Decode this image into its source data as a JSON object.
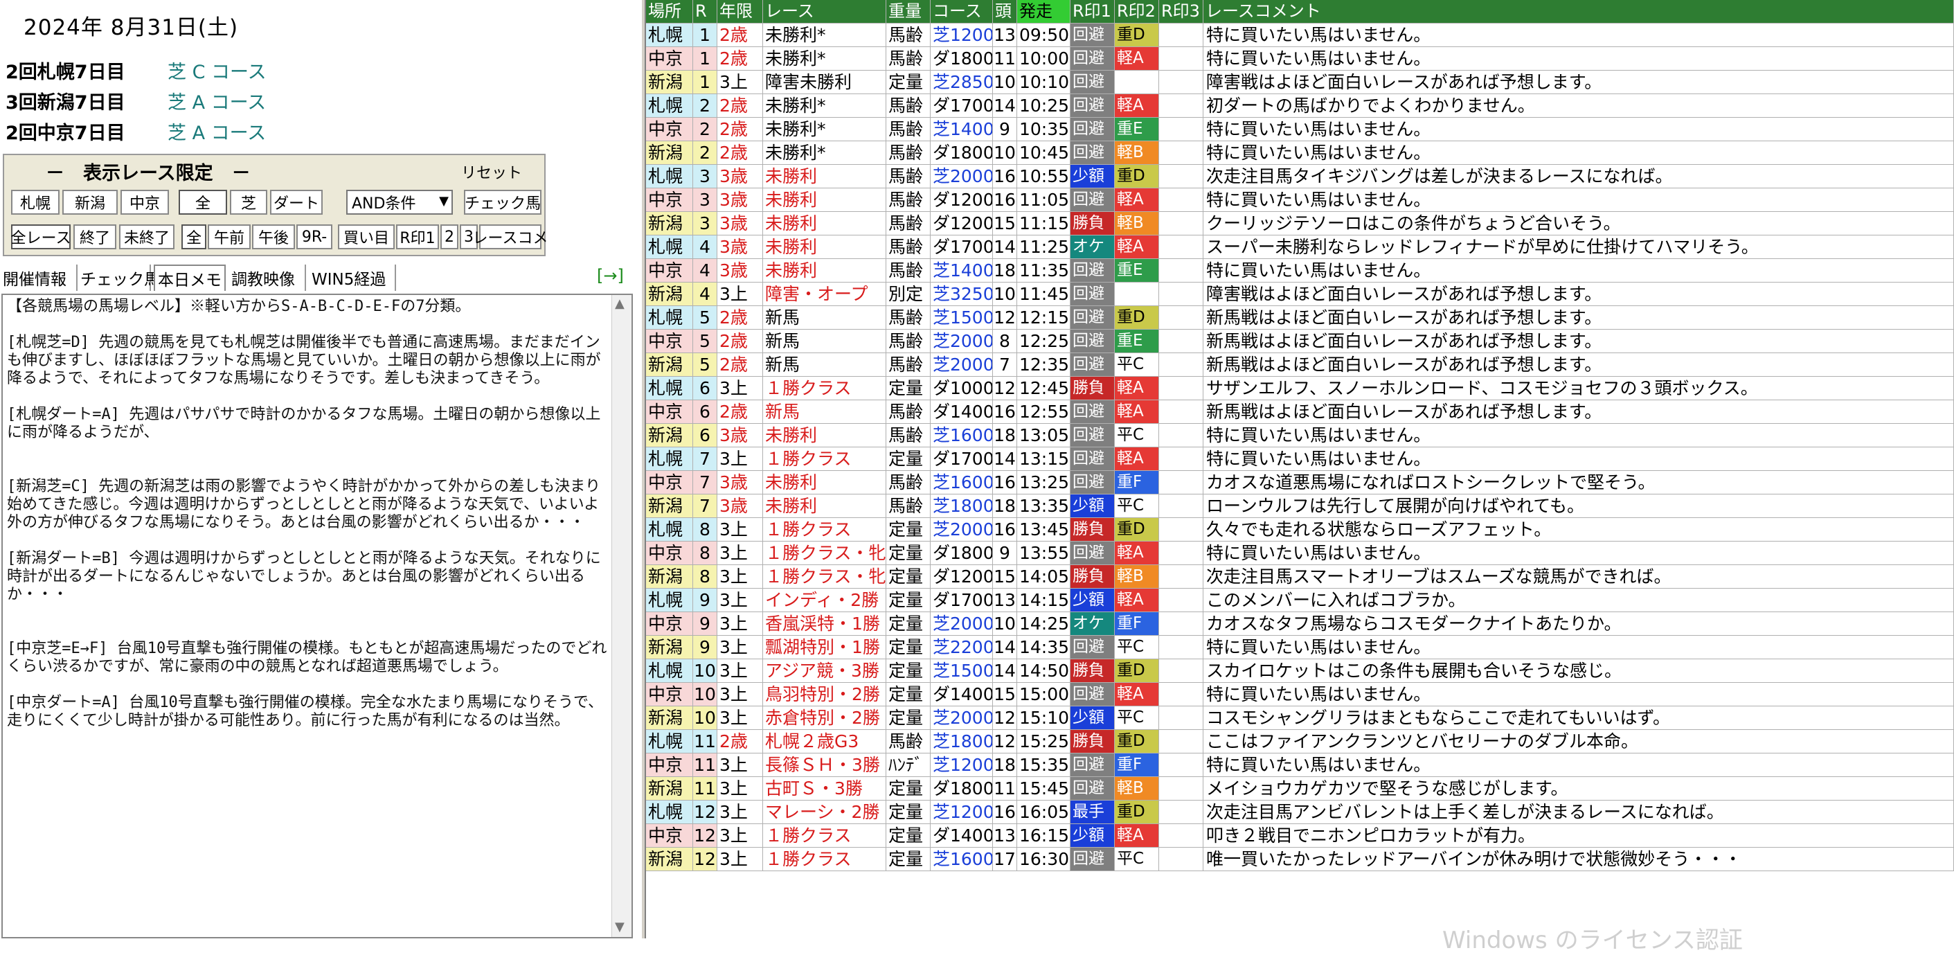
{
  "date": "2024年 8月31日(土)",
  "meetings": [
    {
      "name": "2回札幌7日目",
      "course": "芝 C コース"
    },
    {
      "name": "3回新潟7日目",
      "course": "芝 A コース"
    },
    {
      "name": "2回中京7日目",
      "course": "芝 A コース"
    }
  ],
  "filter": {
    "title": "－　表示レース限定　－",
    "reset": "リセット",
    "row1": [
      "札幌",
      "新潟",
      "中京",
      "全",
      "芝",
      "ダート"
    ],
    "condition": "AND条件",
    "check_horse": "チェック馬",
    "row2": [
      "全レース",
      "終了",
      "未終了",
      "全",
      "午前",
      "午後",
      "9R-",
      "買い目",
      "R印1",
      "2",
      "3",
      "レースコメ"
    ]
  },
  "tabs": [
    "開催情報",
    "チェック馬",
    "本日メモ",
    "調教映像",
    "WIN5経過"
  ],
  "expand_label": "[→]",
  "memo": "【各競馬場の馬場レベル】※軽い方からS-A-B-C-D-E-Fの7分類。\n\n[札幌芝=D] 先週の競馬を見ても札幌芝は開催後半でも普通に高速馬場。まだまだインも伸びますし、ほぼほぼフラットな馬場と見ていいか。土曜日の朝から想像以上に雨が降るようで、それによってタフな馬場になりそうです。差しも決まってきそう。\n\n[札幌ダート=A] 先週はパサパサで時計のかかるタフな馬場。土曜日の朝から想像以上に雨が降るようだが、\n\n\n[新潟芝=C] 先週の新潟芝は雨の影響でようやく時計がかかって外からの差しも決まり始めてきた感じ。今週は週明けからずっとしとしとと雨が降るような天気で、いよいよ外の方が伸びるタフな馬場になりそう。あとは台風の影響がどれくらい出るか・・・\n\n[新潟ダート=B] 今週は週明けからずっとしとしとと雨が降るような天気。それなりに時計が出るダートになるんじゃないでしょうか。あとは台風の影響がどれくらい出るか・・・\n\n\n[中京芝=E→F] 台風10号直撃も強行開催の模様。もともとが超高速馬場だったのでどれくらい渋るかですが、常に豪雨の中の競馬となれば超道悪馬場でしょう。\n\n[中京ダート=A] 台風10号直撃も強行開催の模様。完全な水たまり馬場になりそうで、走りにくくて少し時計が掛かる可能性あり。前に行った馬が有利になるのは当然。",
  "table": {
    "headers": [
      "場所",
      "R",
      "年限",
      "レース",
      "重量",
      "コース",
      "頭",
      "発走",
      "R印1",
      "R印2",
      "R印3",
      "レースコメント"
    ],
    "rows": [
      [
        "札幌",
        "1",
        "2歳",
        "未勝利*",
        "馬齢",
        "芝1200",
        "13",
        "09:50",
        "回避",
        "重D",
        "",
        "特に買いたい馬はいません。"
      ],
      [
        "中京",
        "1",
        "2歳",
        "未勝利*",
        "馬齢",
        "ダ1800",
        "11",
        "10:00",
        "回避",
        "軽A",
        "",
        "特に買いたい馬はいません。"
      ],
      [
        "新潟",
        "1",
        "3上",
        "障害未勝利",
        "定量",
        "芝2850",
        "10",
        "10:10",
        "回避",
        "",
        "",
        "障害戦はよほど面白いレースがあれば予想します。"
      ],
      [
        "札幌",
        "2",
        "2歳",
        "未勝利*",
        "馬齢",
        "ダ1700",
        "14",
        "10:25",
        "回避",
        "軽A",
        "",
        "初ダートの馬ばかりでよくわかりません。"
      ],
      [
        "中京",
        "2",
        "2歳",
        "未勝利*",
        "馬齢",
        "芝1400",
        "9",
        "10:35",
        "回避",
        "重E",
        "",
        "特に買いたい馬はいません。"
      ],
      [
        "新潟",
        "2",
        "2歳",
        "未勝利*",
        "馬齢",
        "ダ1800",
        "10",
        "10:45",
        "回避",
        "軽B",
        "",
        "特に買いたい馬はいません。"
      ],
      [
        "札幌",
        "3",
        "3歳",
        "未勝利",
        "馬齢",
        "芝2000",
        "16",
        "10:55",
        "少額",
        "重D",
        "",
        "次走注目馬タイキジバングは差しが決まるレースになれば。"
      ],
      [
        "中京",
        "3",
        "3歳",
        "未勝利",
        "馬齢",
        "ダ1200",
        "16",
        "11:05",
        "回避",
        "軽A",
        "",
        "特に買いたい馬はいません。"
      ],
      [
        "新潟",
        "3",
        "3歳",
        "未勝利",
        "馬齢",
        "ダ1200",
        "15",
        "11:15",
        "勝負",
        "軽B",
        "",
        "クーリッジテソーロはこの条件がちょうど合いそう。"
      ],
      [
        "札幌",
        "4",
        "3歳",
        "未勝利",
        "馬齢",
        "ダ1700",
        "14",
        "11:25",
        "オケ",
        "軽A",
        "",
        "スーパー未勝利ならレッドレフィナードが早めに仕掛けてハマリそう。"
      ],
      [
        "中京",
        "4",
        "3歳",
        "未勝利",
        "馬齢",
        "芝1400",
        "18",
        "11:35",
        "回避",
        "重E",
        "",
        "特に買いたい馬はいません。"
      ],
      [
        "新潟",
        "4",
        "3上",
        "障害・オープ",
        "別定",
        "芝3250",
        "10",
        "11:45",
        "回避",
        "",
        "",
        "障害戦はよほど面白いレースがあれば予想します。"
      ],
      [
        "札幌",
        "5",
        "2歳",
        "新馬",
        "馬齢",
        "芝1500",
        "12",
        "12:15",
        "回避",
        "重D",
        "",
        "新馬戦はよほど面白いレースがあれば予想します。"
      ],
      [
        "中京",
        "5",
        "2歳",
        "新馬",
        "馬齢",
        "芝2000",
        "8",
        "12:25",
        "回避",
        "重E",
        "",
        "新馬戦はよほど面白いレースがあれば予想します。"
      ],
      [
        "新潟",
        "5",
        "2歳",
        "新馬",
        "馬齢",
        "芝2000",
        "7",
        "12:35",
        "回避",
        "平C",
        "",
        "新馬戦はよほど面白いレースがあれば予想します。"
      ],
      [
        "札幌",
        "6",
        "3上",
        "１勝クラス",
        "定量",
        "ダ1000",
        "12",
        "12:45",
        "勝負",
        "軽A",
        "",
        "サザンエルフ、スノーホルンロード、コスモジョセフの３頭ボックス。"
      ],
      [
        "中京",
        "6",
        "2歳",
        "新馬",
        "馬齢",
        "ダ1400",
        "16",
        "12:55",
        "回避",
        "軽A",
        "",
        "新馬戦はよほど面白いレースがあれば予想します。"
      ],
      [
        "新潟",
        "6",
        "3歳",
        "未勝利",
        "馬齢",
        "芝1600",
        "18",
        "13:05",
        "回避",
        "平C",
        "",
        "特に買いたい馬はいません。"
      ],
      [
        "札幌",
        "7",
        "3上",
        "１勝クラス",
        "定量",
        "ダ1700",
        "14",
        "13:15",
        "回避",
        "軽A",
        "",
        "特に買いたい馬はいません。"
      ],
      [
        "中京",
        "7",
        "3歳",
        "未勝利",
        "馬齢",
        "芝1600",
        "16",
        "13:25",
        "回避",
        "重F",
        "",
        "カオスな道悪馬場になればロストシークレットで堅そう。"
      ],
      [
        "新潟",
        "7",
        "3歳",
        "未勝利",
        "馬齢",
        "芝1800",
        "18",
        "13:35",
        "少額",
        "平C",
        "",
        "ローンウルフは先行して展開が向けばやれても。"
      ],
      [
        "札幌",
        "8",
        "3上",
        "１勝クラス",
        "定量",
        "芝2000",
        "16",
        "13:45",
        "勝負",
        "重D",
        "",
        "久々でも走れる状態ならローズアフェット。"
      ],
      [
        "中京",
        "8",
        "3上",
        "１勝クラス・牝",
        "定量",
        "ダ1800",
        "9",
        "13:55",
        "回避",
        "軽A",
        "",
        "特に買いたい馬はいません。"
      ],
      [
        "新潟",
        "8",
        "3上",
        "１勝クラス・牝",
        "定量",
        "ダ1200",
        "15",
        "14:05",
        "勝負",
        "軽B",
        "",
        "次走注目馬スマートオリーブはスムーズな競馬ができれば。"
      ],
      [
        "札幌",
        "9",
        "3上",
        "インディ・2勝",
        "定量",
        "ダ1700",
        "13",
        "14:15",
        "少額",
        "軽A",
        "",
        "このメンバーに入ればコブラか。"
      ],
      [
        "中京",
        "9",
        "3上",
        "香嵐渓特・1勝",
        "定量",
        "芝2000",
        "10",
        "14:25",
        "オケ",
        "重F",
        "",
        "カオスなタフ馬場ならコスモダークナイトあたりか。"
      ],
      [
        "新潟",
        "9",
        "3上",
        "瓢湖特別・1勝",
        "定量",
        "芝2200",
        "14",
        "14:35",
        "回避",
        "平C",
        "",
        "特に買いたい馬はいません。"
      ],
      [
        "札幌",
        "10",
        "3上",
        "アジア競・3勝",
        "定量",
        "芝1500",
        "14",
        "14:50",
        "勝負",
        "重D",
        "",
        "スカイロケットはこの条件も展開も合いそうな感じ。"
      ],
      [
        "中京",
        "10",
        "3上",
        "鳥羽特別・2勝",
        "定量",
        "ダ1400",
        "15",
        "15:00",
        "回避",
        "軽A",
        "",
        "特に買いたい馬はいません。"
      ],
      [
        "新潟",
        "10",
        "3上",
        "赤倉特別・2勝",
        "定量",
        "芝2000",
        "12",
        "15:10",
        "少額",
        "平C",
        "",
        "コスモシャングリラはまともならここで走れてもいいはず。"
      ],
      [
        "札幌",
        "11",
        "2歳",
        "札幌２歳G3",
        "馬齢",
        "芝1800",
        "12",
        "15:25",
        "勝負",
        "重D",
        "",
        "ここはファイアンクランツとバセリーナのダブル本命。"
      ],
      [
        "中京",
        "11",
        "3上",
        "長篠ＳＨ・3勝",
        "ﾊﾝﾃﾞ",
        "芝1200",
        "18",
        "15:35",
        "回避",
        "重F",
        "",
        "特に買いたい馬はいません。"
      ],
      [
        "新潟",
        "11",
        "3上",
        "古町Ｓ・3勝",
        "定量",
        "ダ1800",
        "11",
        "15:45",
        "回避",
        "軽B",
        "",
        "メイショウカゲカツで堅そうな感じがします。"
      ],
      [
        "札幌",
        "12",
        "3上",
        "マレーシ・2勝",
        "定量",
        "芝1200",
        "16",
        "16:05",
        "最手",
        "重D",
        "",
        "次走注目馬アンビバレントは上手く差しが決まるレースになれば。"
      ],
      [
        "中京",
        "12",
        "3上",
        "１勝クラス",
        "定量",
        "ダ1400",
        "13",
        "16:15",
        "少額",
        "軽A",
        "",
        "叩き２戦目でニホンピロカラットが有力。"
      ],
      [
        "新潟",
        "12",
        "3上",
        "１勝クラス",
        "定量",
        "芝1600",
        "17",
        "16:30",
        "回避",
        "平C",
        "",
        "唯一買いたかったレッドアーバインが休み明けで状態微妙そう・・・"
      ]
    ]
  },
  "colors": {
    "header_bg": "#2e7d32",
    "start_header_bg": "#33cc33",
    "sapporo": "#cfeff7",
    "chukyo": "#f8d8d8",
    "niigata": "#f6f3b0",
    "avoid": "#7f7f7f",
    "small_bet": "#1a3fd8",
    "bet": "#c62828",
    "ok": "#15887e",
    "grade_A": "#e53935",
    "grade_B": "#f08a24",
    "grade_D": "#c9c94a",
    "grade_E": "#2e9c4a",
    "grade_F": "#2b63e0"
  },
  "watermark": "Windows のライセンス認証"
}
